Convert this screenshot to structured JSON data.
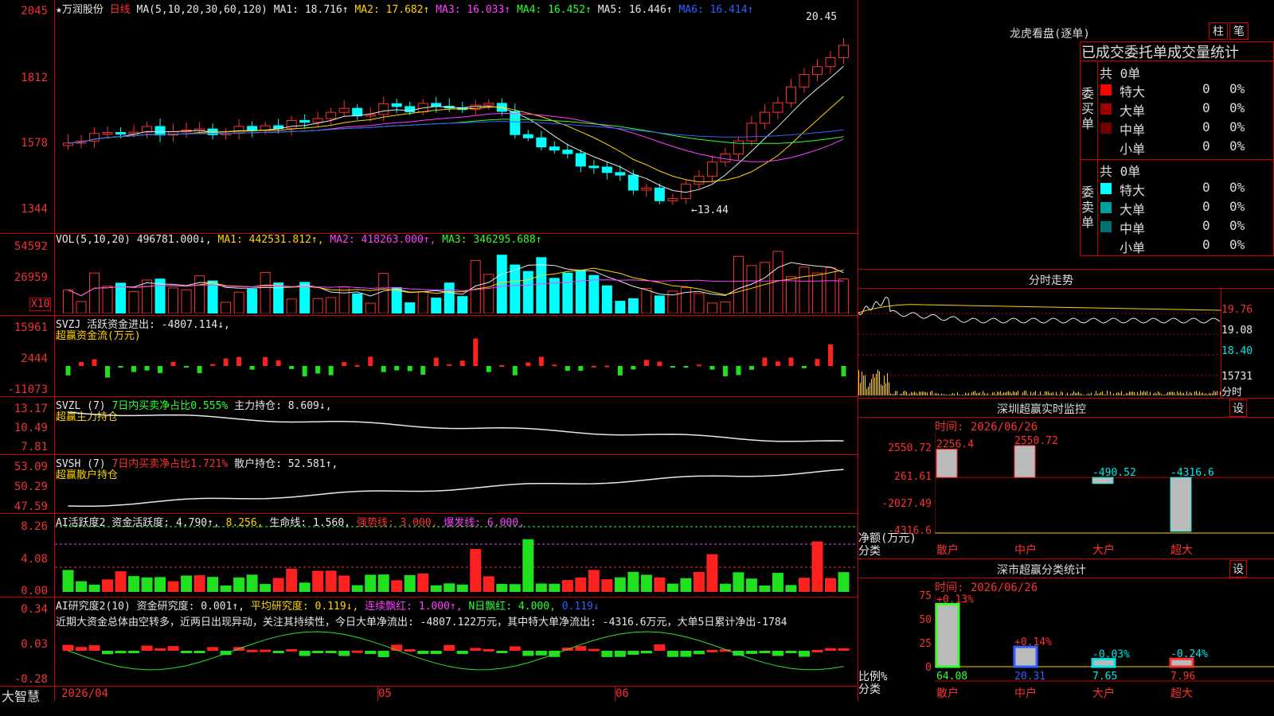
{
  "left_chart": {
    "stock_name": "万润股份",
    "period": "日线",
    "ma_header": "MA(5,10,20,30,60,120)",
    "ma_values": [
      {
        "label": "MA1: 18.716↑",
        "color": "#e8e8e8"
      },
      {
        "label": "MA2: 17.682↑",
        "color": "#ffd400"
      },
      {
        "label": "MA3: 16.033↑",
        "color": "#ff40ff"
      },
      {
        "label": "MA4: 16.452↑",
        "color": "#30ff30"
      },
      {
        "label": "MA5: 16.446↑",
        "color": "#e8e8e8"
      },
      {
        "label": "MA6: 16.414↑",
        "color": "#3060ff"
      }
    ],
    "price_axis": [
      "2045",
      "1812",
      "1578",
      "1344"
    ],
    "high_marker": "20.45",
    "low_marker": "←13.44",
    "vol_header": "VOL(5,10,20)",
    "vol_values": [
      {
        "label": "496781.000↓,",
        "color": "#e8e8e8"
      },
      {
        "label": "MA1: 442531.812↑,",
        "color": "#ffd400"
      },
      {
        "label": "MA2: 418263.000↑,",
        "color": "#ff40ff"
      },
      {
        "label": "MA3: 346295.688↑",
        "color": "#30ff30"
      }
    ],
    "vol_axis": [
      "54592",
      "26959"
    ],
    "vol_unit": "X10",
    "svzj_header": "SVZJ  活跃资金进出: -4807.114↓,",
    "svzj_sub": "超赢资金流(万元)",
    "svzj_axis": [
      "15961",
      "2444",
      "-11073"
    ],
    "svzl_header_a": "SVZL (7)",
    "svzl_header_b": "7日内买卖净占比0.555%",
    "svzl_header_c": "主力持仓: 8.609↓,",
    "svzl_sub": "超赢主力持仓",
    "svzl_axis": [
      "13.17",
      "10.49",
      "7.81"
    ],
    "svsh_header_a": "SVSH (7)",
    "svsh_header_b": "7日内买卖净占比1.721%",
    "svsh_header_c": "散户持仓: 52.581↑,",
    "svsh_sub": "超赢散户持仓",
    "svsh_axis": [
      "53.09",
      "50.29",
      "47.59"
    ],
    "ai1_header": [
      {
        "label": "AI活跃度2 资金活跃度: 4.790↑,",
        "color": "#e8e8e8"
      },
      {
        "label": "8.256,",
        "color": "#ffd400"
      },
      {
        "label": "生命线: 1.560,",
        "color": "#e8e8e8"
      },
      {
        "label": "强势线: 3.000,",
        "color": "#ff3030"
      },
      {
        "label": "爆发线: 6.000,",
        "color": "#ff40ff"
      }
    ],
    "ai1_axis": [
      "8.26",
      "4.08",
      "0.00"
    ],
    "ai2_header": [
      {
        "label": "AI研究度2(10) 资金研究度: 0.001↑,",
        "color": "#e8e8e8"
      },
      {
        "label": "平均研究度: 0.119↓,",
        "color": "#ffd400"
      },
      {
        "label": "连续飘红: 1.000↑,",
        "color": "#ff40ff"
      },
      {
        "label": "N日飘红: 4.000,",
        "color": "#30ff30"
      },
      {
        "label": "0.119↓",
        "color": "#3060ff"
      }
    ],
    "ai2_comment": "近期大资金总体由空转多，近两日出现异动，关注其持续性，今日大单净流出: -4807.122万元，其中特大单净流出: -4316.6万元，大单5日累计净出-1784",
    "ai2_axis": [
      "0.34",
      "0.03",
      "-0.28"
    ],
    "date_labels": [
      "2026/04",
      "05",
      "06"
    ],
    "brand": "大智慧"
  },
  "dragon_tiger": {
    "title": "龙虎看盘(逐单)",
    "btn_a": "柱",
    "btn_b": "笔",
    "header": "已成交委托单成交量统计",
    "buy_label": "委买单",
    "sell_label": "委卖单",
    "buy_total": "共 0单",
    "sell_total": "共 0单",
    "buy_rows": [
      {
        "name": "特大",
        "count": "0",
        "pct": "0%",
        "color": "#ff0000"
      },
      {
        "name": "大单",
        "count": "0",
        "pct": "0%",
        "color": "#a00000"
      },
      {
        "name": "中单",
        "count": "0",
        "pct": "0%",
        "color": "#700000"
      },
      {
        "name": "小单",
        "count": "0",
        "pct": "0%",
        "color": "#000000"
      }
    ],
    "sell_rows": [
      {
        "name": "特大",
        "count": "0",
        "pct": "0%",
        "color": "#00ffff"
      },
      {
        "name": "大单",
        "count": "0",
        "pct": "0%",
        "color": "#00a0a0"
      },
      {
        "name": "中单",
        "count": "0",
        "pct": "0%",
        "color": "#007070"
      },
      {
        "name": "小单",
        "count": "0",
        "pct": "0%",
        "color": "#000000"
      }
    ]
  },
  "intraday": {
    "title": "分时走势",
    "axis": [
      "19.76",
      "19.08",
      "18.40",
      "15731"
    ],
    "unit": "分时"
  },
  "monitor": {
    "title": "深圳超赢实时监控",
    "btn": "设",
    "date": "时间: 2026/06/26",
    "axis": [
      "2550.72",
      "261.61",
      "-2027.49",
      "-4316.6"
    ],
    "y_name": "净额(万元)",
    "x_name": "分类",
    "categories": [
      "散户",
      "中户",
      "大户",
      "超大"
    ],
    "values": [
      "2256.4",
      "2550.72",
      "-490.52",
      "-4316.6"
    ]
  },
  "classify": {
    "title": "深市超赢分类统计",
    "btn": "设",
    "date": "时间: 2026/06/26",
    "axis": [
      "75",
      "50",
      "25",
      "0"
    ],
    "y_name": "比例%",
    "x_name": "分类",
    "categories": [
      "散户",
      "中户",
      "大户",
      "超大"
    ],
    "pct_changes": [
      "+0.13%",
      "+0.14%",
      "-0.03%",
      "-0.24%"
    ],
    "values": [
      "64.08",
      "20.31",
      "7.65",
      "7.96"
    ]
  }
}
